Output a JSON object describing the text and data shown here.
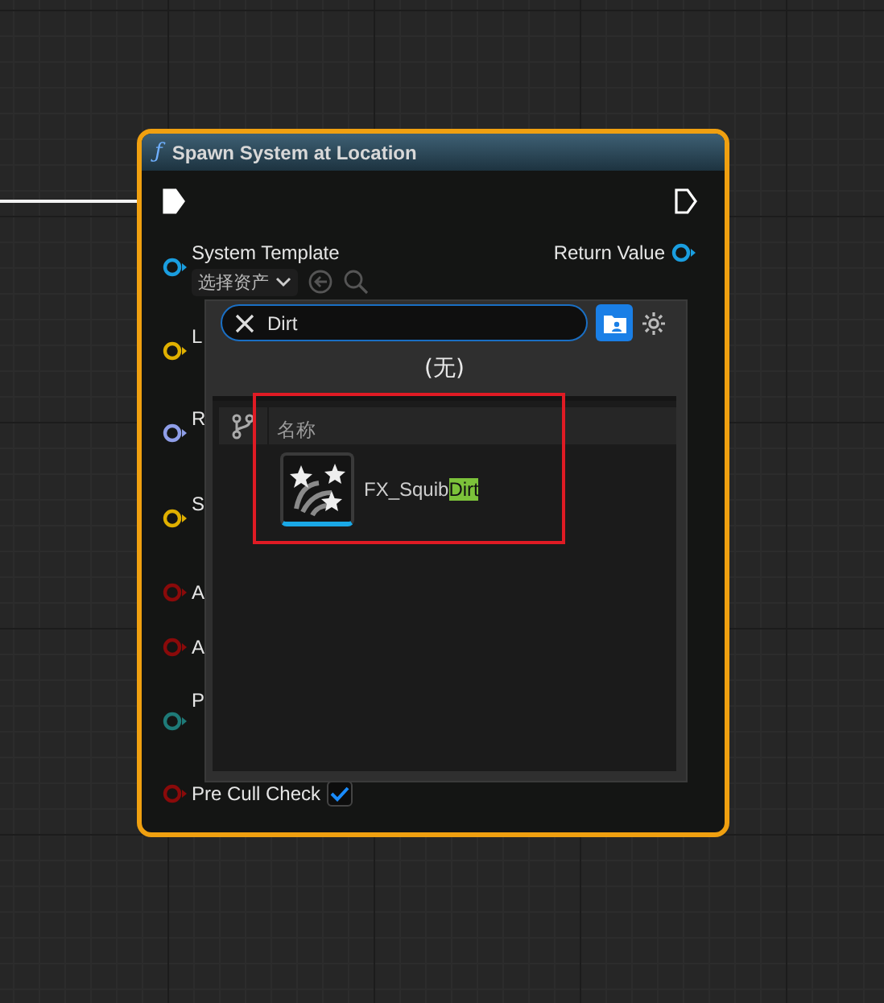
{
  "node": {
    "glyph": "ƒ",
    "title": "Spawn System at Location",
    "exec": {
      "input_connected": true,
      "output_connected": false
    },
    "return_pin": {
      "label": "Return Value",
      "color": "#1a9ee0"
    },
    "pins": [
      {
        "label": "System Template",
        "color": "#1a9ee0",
        "kind": "asset",
        "dropdown": "选择资产"
      },
      {
        "label": "L",
        "color": "#e0b000",
        "kind": "plain"
      },
      {
        "label": "R",
        "color": "#8f9ee8",
        "kind": "plain"
      },
      {
        "label": "S",
        "color": "#e0b000",
        "kind": "plain"
      },
      {
        "label": "A",
        "color": "#8a0a0a",
        "kind": "plain"
      },
      {
        "label": "A",
        "color": "#8a0a0a",
        "kind": "plain"
      },
      {
        "label": "P",
        "color": "#1e7a78",
        "kind": "plain"
      },
      {
        "label": "Pre Cull Check",
        "color": "#8a0a0a",
        "kind": "checkbox",
        "checked": true
      }
    ]
  },
  "asset_picker": {
    "search": {
      "value": "Dirt"
    },
    "none_label": "(无)",
    "column": "名称",
    "assets": [
      {
        "name": "FX_Squib",
        "match": "Dirt",
        "annotated": true
      }
    ]
  }
}
